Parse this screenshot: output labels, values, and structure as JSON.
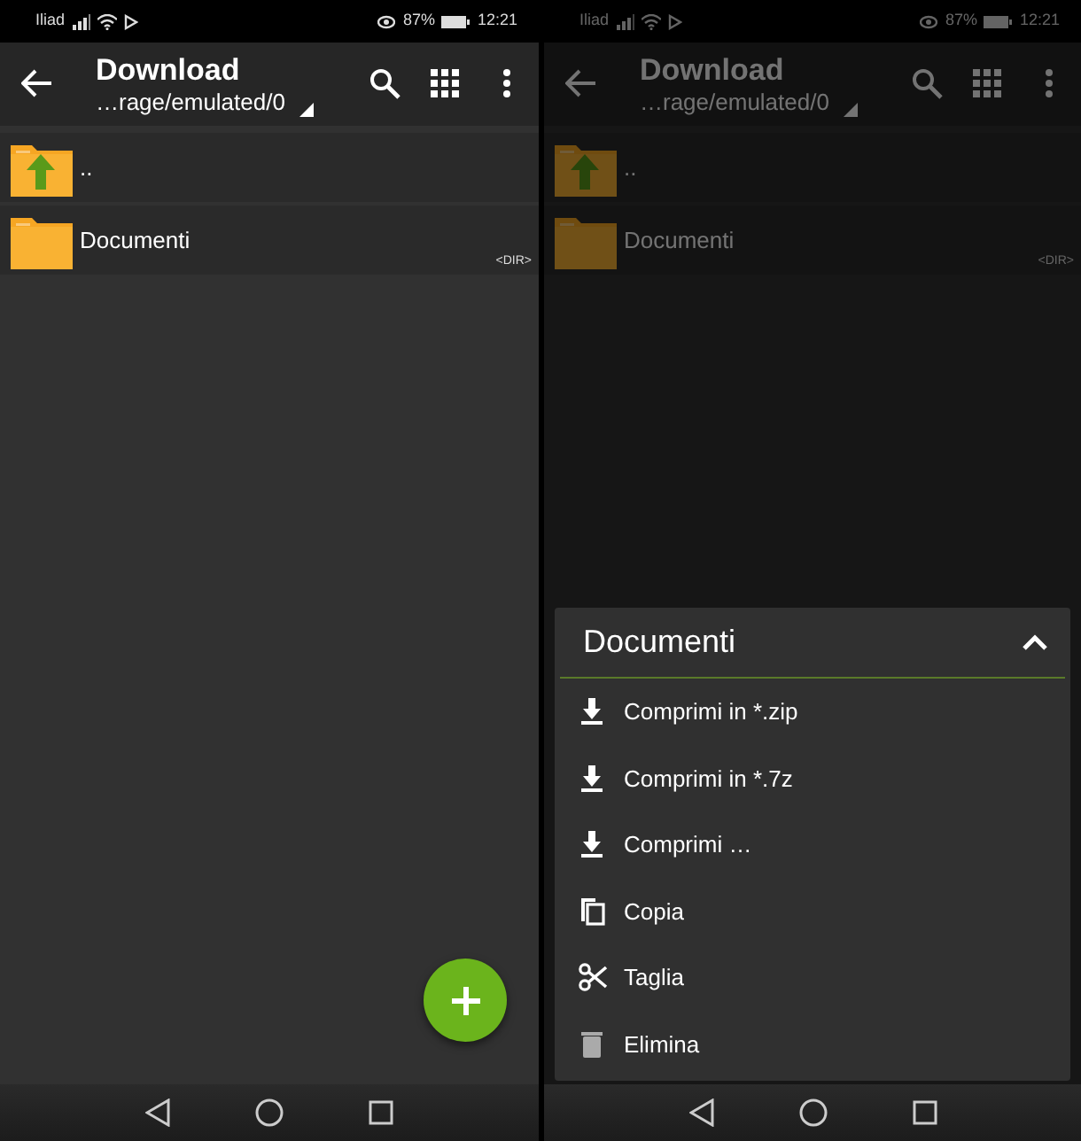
{
  "screens": [
    {
      "status_bar": {
        "carrier": "Iliad",
        "battery": "87%",
        "time": "12:21"
      },
      "toolbar": {
        "title": "Download",
        "path": "…rage/emulated/0"
      },
      "files": [
        {
          "kind": "parent",
          "name": ".."
        },
        {
          "kind": "folder",
          "name": "Documenti",
          "tag": "<DIR>"
        }
      ],
      "dimmed": false,
      "fab": true
    },
    {
      "status_bar": {
        "carrier": "Iliad",
        "battery": "87%",
        "time": "12:21"
      },
      "toolbar": {
        "title": "Download",
        "path": "…rage/emulated/0"
      },
      "files": [
        {
          "kind": "parent",
          "name": ".."
        },
        {
          "kind": "folder",
          "name": "Documenti",
          "tag": "<DIR>"
        }
      ],
      "dimmed": true,
      "fab": false,
      "menu": {
        "title": "Documenti",
        "expanded": true,
        "items": [
          {
            "kind": "compress",
            "label": "Comprimi in *.zip"
          },
          {
            "kind": "compress",
            "label": "Comprimi in *.7z"
          },
          {
            "kind": "compress",
            "label": "Comprimi …"
          },
          {
            "kind": "copy",
            "label": "Copia"
          },
          {
            "kind": "cut",
            "label": "Taglia"
          },
          {
            "kind": "delete",
            "label": "Elimina"
          }
        ]
      }
    }
  ]
}
